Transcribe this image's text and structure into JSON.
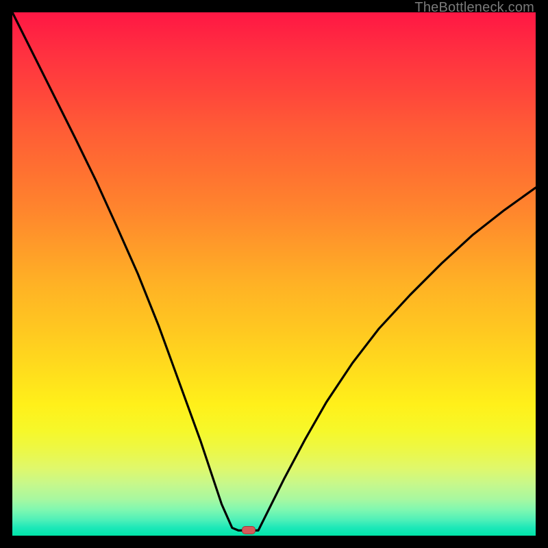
{
  "watermark": {
    "text": "TheBottleneck.com"
  },
  "colors": {
    "frame": "#000000",
    "curve": "#000000",
    "marker_fill": "#d45a5a",
    "marker_border": "#a03a3a"
  },
  "chart_data": {
    "type": "line",
    "title": "",
    "xlabel": "",
    "ylabel": "",
    "xlim": [
      0,
      1
    ],
    "ylim": [
      0,
      1
    ],
    "grid": false,
    "legend": false,
    "series": [
      {
        "name": "left-branch",
        "x": [
          0.0,
          0.04,
          0.08,
          0.12,
          0.16,
          0.2,
          0.24,
          0.28,
          0.32,
          0.36,
          0.38,
          0.4,
          0.42,
          0.432
        ],
        "y": [
          1.0,
          0.92,
          0.84,
          0.76,
          0.678,
          0.59,
          0.5,
          0.4,
          0.29,
          0.18,
          0.12,
          0.06,
          0.015,
          0.01
        ]
      },
      {
        "name": "notch-floor",
        "x": [
          0.432,
          0.47
        ],
        "y": [
          0.01,
          0.01
        ]
      },
      {
        "name": "right-branch",
        "x": [
          0.47,
          0.49,
          0.52,
          0.56,
          0.6,
          0.65,
          0.7,
          0.76,
          0.82,
          0.88,
          0.94,
          1.0
        ],
        "y": [
          0.01,
          0.05,
          0.11,
          0.185,
          0.255,
          0.33,
          0.395,
          0.46,
          0.52,
          0.575,
          0.622,
          0.665
        ]
      }
    ],
    "marker": {
      "x": 0.452,
      "y": 0.01
    }
  }
}
